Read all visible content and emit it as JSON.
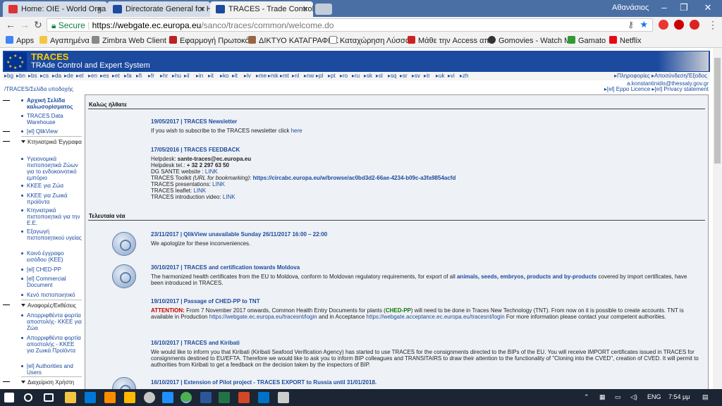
{
  "browser": {
    "tabs": [
      {
        "label": "Home: OIE - World Orga",
        "active": false
      },
      {
        "label": "Directorate General for H",
        "active": false
      },
      {
        "label": "TRACES - Trade Control a",
        "active": true
      }
    ],
    "window_user": "Αθανάσιος",
    "secure_label": "Secure",
    "url_host": "https://webgate.ec.europa.eu",
    "url_path": "/sanco/traces/common/welcome.do",
    "bookmarks": [
      "Apps",
      "Αγαπημένα",
      "Zimbra Web Client Si",
      "Εφαρμογή Πρωτοκό",
      "ΔΙΚΤΥΟ ΚΑΤΑΓΡΑΦΗΣ",
      "Καταχώρηση Λύσσο",
      "Μάθε την Access απ",
      "Gomovies - Watch M",
      "Gamato",
      "Netflix"
    ]
  },
  "header": {
    "brand": "TRACES",
    "subtitle": "TRAde Control and Expert System",
    "languages": [
      "bg",
      "bn",
      "bs",
      "cs",
      "da",
      "de",
      "el",
      "en",
      "es",
      "et",
      "fa",
      "fi",
      "fr",
      "hr",
      "hu",
      "il",
      "in",
      "it",
      "ko",
      "lt",
      "lv",
      "me",
      "mk",
      "mt",
      "nl",
      "nw",
      "pl",
      "pt",
      "ro",
      "ru",
      "sk",
      "sl",
      "sq",
      "sr",
      "sv",
      "tr",
      "uk",
      "vi",
      "zh"
    ],
    "top_links": "▸Πληροφορίες ▸Αποσύνδεση/Έξοδος",
    "user": "a.konstantinidis@thessaly.gov.gr",
    "breadcrumb": "/TRACES/Σελίδα υποδοχής",
    "right_links": "▸[el] Eppo Licence ▸[el] Privacy statement"
  },
  "sidebar": [
    {
      "label": "Αρχική Σελίδα καλωσορίσματος",
      "kind": "bold"
    },
    {
      "label": "TRACES Data Warehouse",
      "kind": "item"
    },
    {
      "label": "[el] QlikView",
      "kind": "item"
    },
    {
      "label": "Κτηνιατρικά Έγγραφα",
      "kind": "head"
    },
    {
      "label": "Υγειονομικά πιστοποιητικά Ζώων για το ενδοκοινοτικό εμπόριο",
      "kind": "item"
    },
    {
      "label": "ΚΚΕΕ για Ζώα",
      "kind": "item"
    },
    {
      "label": "ΚΚΕΕ για Ζωικά προϊόντα",
      "kind": "item"
    },
    {
      "label": "Κτηνιατρικά πιστοποιητικά για την Ε.Ε.",
      "kind": "item"
    },
    {
      "label": "Εξαγωγή πιστοποιητικού υγείας",
      "kind": "item"
    },
    {
      "label": "Κοινό έγγραφο εισόδου (ΚΕΕ)",
      "kind": "item"
    },
    {
      "label": "[el] CHED-PP",
      "kind": "item"
    },
    {
      "label": "[el] Commercial Document",
      "kind": "item"
    },
    {
      "label": "Κενό πιστοποιητικό",
      "kind": "item"
    },
    {
      "label": "Αναφορές/Εκθέσεις",
      "kind": "head"
    },
    {
      "label": "Απορριφθέντα φορτία αποστολής- ΚΚΕΕ για Ζώα",
      "kind": "item"
    },
    {
      "label": "Απορριφθέντα φορτία αποστολής - ΚΚΕΕ για Ζωικά Προϊόντα",
      "kind": "item"
    },
    {
      "label": "[el] Authorities and Users",
      "kind": "item"
    },
    {
      "label": "Διαχείριση Χρήστη",
      "kind": "head"
    }
  ],
  "main": {
    "welcome": "Καλώς ήλθατε",
    "latest": "Τελευταία νέα",
    "n1_title": "19/05/2017 | TRACES Newsletter",
    "n1_text": "If you wish to subscribe to the TRACES newsletter click ",
    "n1_link": "here",
    "n2_title": "17/05/2016 | TRACES FEEDBACK",
    "n2_l1a": "Helpdesk: ",
    "n2_l1b": "sante-traces@ec.europa.eu",
    "n2_l2a": "Helpdesk tel.: ",
    "n2_l2b": "+ 32 2 297 63 50",
    "n2_l3a": "DG SANTE website : ",
    "n2_l3b": "LINK",
    "n2_l4a": "TRACES Toolkit ",
    "n2_l4b": "(URL for bookmarking)",
    "n2_l4c": ": ",
    "n2_l4d": "https://circabc.europa.eu/w/browse/ac0bd3d2-66ae-4234-b09c-a3fa9854acfd",
    "n2_l5a": "TRACES presentations: ",
    "n2_l5b": "LINK",
    "n2_l6a": "TRACES leaflet: ",
    "n2_l6b": "LINK",
    "n2_l7a": "TRACES introduction video: ",
    "n2_l7b": "LINK",
    "n3_title": "23/11/2017 | QlikView unavailable Sunday 26/11/2017 16:00 – 22:00",
    "n3_text": "We apologize for these inconveniences.",
    "n4_title": "30/10/2017 | TRACES and certification towards Moldova",
    "n4_a": "The harmonized health certificates from the EU to Moldova, conform to Moldovan regulatory requirements, for export of all ",
    "n4_b": "animals, seeds, embryos, products and by-products",
    "n4_c": " covered by import certificates, have been introduced in TRACES.",
    "n5_title": "19/10/2017 | Passage of CHED-PP to TNT",
    "n5_a": "ATTENTION:",
    "n5_b": " From 7 November 2017 onwards, Common Health Entry Documents for plants (",
    "n5_c": "CHED-PP",
    "n5_d": ") will need to be done in Traces New Technology (TNT). From now on it is possible to create accounts. TNT is available in Production ",
    "n5_e": "https://webgate.ec.europa.eu/tracesnt/login",
    "n5_f": " and in Acceptance ",
    "n5_g": "https://webgate.acceptance.ec.europa.eu/tracesnt/login",
    "n5_h": " For more information please contact your competent authorities.",
    "n6_title": "16/10/2017 | TRACES and Kiribati",
    "n6_text": "We would like to inform you that Kiribati (Kiribati Seafood Verification Agency) has started to use TRACES for the consignments directed to the BIPs of the EU. You will receive IMPORT certificates issued in TRACES for consignments destined to EU/EFTA. Therefore we would like to ask you to inform BIP colleagues and TRANSITAIRS to draw their attention to the functionality of \"Cloning into the CVED\", creation of CVED. It will permit to authorities from Kiribati to get a feedback on the decision taken by the inspectors of BIP.",
    "n7_title": "16/10/2017 | Extension of Pilot project - TRACES EXPORT to Russia until 31/01/2018."
  },
  "taskbar": {
    "lang": "ENG",
    "time": "7:54 μμ"
  }
}
